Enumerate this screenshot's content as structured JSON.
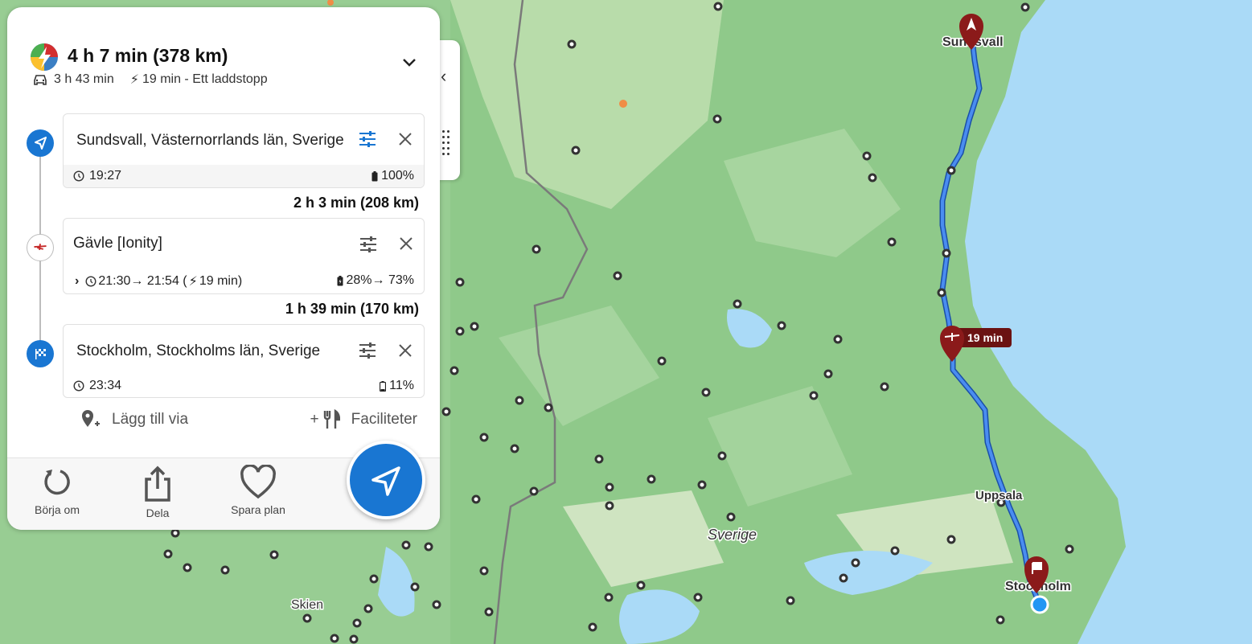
{
  "summary": {
    "total": "4 h 7 min (378 km)",
    "drive_time": "3 h 43 min",
    "charge_info": "19 min - Ett laddstopp"
  },
  "stops": [
    {
      "name": "Sundsvall, Västernorrlands län, Sverige",
      "time": "19:27",
      "battery": "100%"
    },
    {
      "name": "Gävle [Ionity]",
      "times": "21:30→ 21:54 (",
      "charge_duration": "19 min)",
      "battery": "28%→ 73%"
    },
    {
      "name": "Stockholm, Stockholms län, Sverige",
      "time": "23:34",
      "battery": "11%"
    }
  ],
  "legs": [
    "2 h 3 min (208 km)",
    "1 h 39 min (170 km)"
  ],
  "actions": {
    "add_via": "Lägg till via",
    "amenities": "Faciliteter",
    "restart": "Börja om",
    "share": "Dela",
    "save_plan": "Spara plan"
  },
  "map": {
    "labels": {
      "sundsvall": "Sundsvall",
      "uppsala": "Uppsala",
      "stockholm": "Stockholm",
      "sverige": "Sverige",
      "skien": "Skien"
    },
    "charge_badge": "19 min",
    "colors": {
      "route": "#3a7bd5",
      "marker": "#8b1a1a",
      "land": "#8fc98a",
      "water": "#aadaf7"
    }
  },
  "icons": [
    "app-logo-icon",
    "car-icon",
    "bolt-icon",
    "chevron-down-icon",
    "chevron-left-icon",
    "drag-handle-icon",
    "navigation-arrow-icon",
    "ionity-icon",
    "finish-flag-icon",
    "tune-icon",
    "close-icon",
    "clock-icon",
    "battery-icon",
    "add-location-icon",
    "restaurant-icon",
    "restart-icon",
    "share-icon",
    "heart-icon"
  ]
}
